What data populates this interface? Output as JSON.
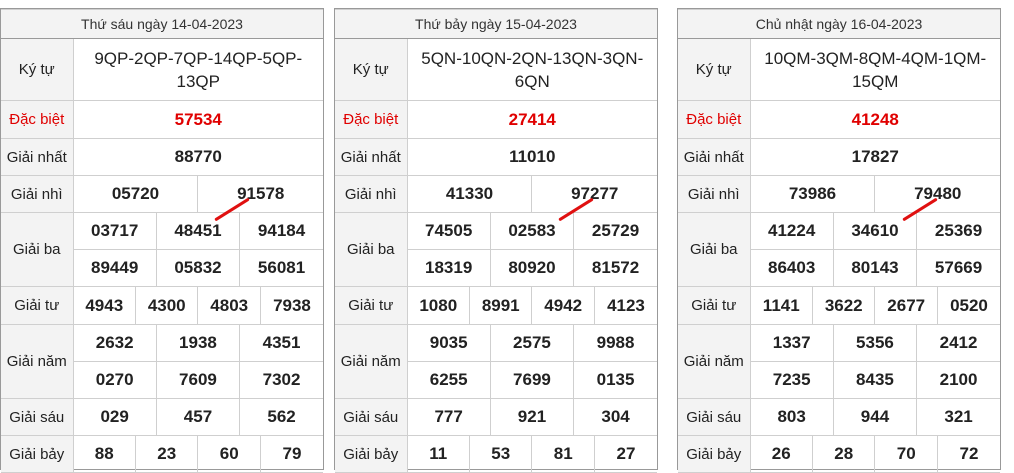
{
  "panels": [
    {
      "date": "Thứ sáu ngày 14-04-2023",
      "kytu": "9QP-2QP-7QP-14QP-5QP-13QP",
      "dacbiet": "57534",
      "nhat": "88770",
      "nhi": [
        "05720",
        "91578"
      ],
      "ba": [
        "03717",
        "48451",
        "94184",
        "89449",
        "05832",
        "56081"
      ],
      "tu": [
        "4943",
        "4300",
        "4803",
        "7938"
      ],
      "nam": [
        "2632",
        "1938",
        "4351",
        "0270",
        "7609",
        "7302"
      ],
      "sau": [
        "029",
        "457",
        "562"
      ],
      "bay": [
        "88",
        "23",
        "60",
        "79"
      ]
    },
    {
      "date": "Thứ bảy ngày 15-04-2023",
      "kytu": "5QN-10QN-2QN-13QN-3QN-6QN",
      "dacbiet": "27414",
      "nhat": "11010",
      "nhi": [
        "41330",
        "97277"
      ],
      "ba": [
        "74505",
        "02583",
        "25729",
        "18319",
        "80920",
        "81572"
      ],
      "tu": [
        "1080",
        "8991",
        "4942",
        "4123"
      ],
      "nam": [
        "9035",
        "2575",
        "9988",
        "6255",
        "7699",
        "0135"
      ],
      "sau": [
        "777",
        "921",
        "304"
      ],
      "bay": [
        "11",
        "53",
        "81",
        "27"
      ]
    },
    {
      "date": "Chủ nhật ngày 16-04-2023",
      "kytu": "10QM-3QM-8QM-4QM-1QM-15QM",
      "dacbiet": "41248",
      "nhat": "17827",
      "nhi": [
        "73986",
        "79480"
      ],
      "ba": [
        "41224",
        "34610",
        "25369",
        "86403",
        "80143",
        "57669"
      ],
      "tu": [
        "1141",
        "3622",
        "2677",
        "0520"
      ],
      "nam": [
        "1337",
        "5356",
        "2412",
        "7235",
        "8435",
        "2100"
      ],
      "sau": [
        "803",
        "944",
        "321"
      ],
      "bay": [
        "26",
        "28",
        "70",
        "72"
      ]
    }
  ],
  "labels": {
    "kytu": "Ký tự",
    "dacbiet": "Đặc biệt",
    "nhat": "Giải nhất",
    "nhi": "Giải nhì",
    "ba": "Giải ba",
    "tu": "Giải tư",
    "nam": "Giải năm",
    "sau": "Giải sáu",
    "bay": "Giải bảy"
  },
  "colors": {
    "special": "#e00000",
    "slash": "#e01010"
  }
}
